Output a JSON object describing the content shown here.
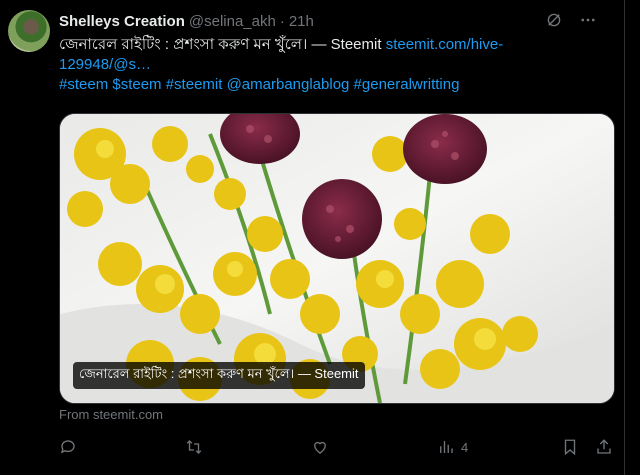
{
  "author": {
    "name": "Shelleys Creation",
    "handle": "@selina_akh",
    "separator": "·",
    "time": "21h"
  },
  "post": {
    "text_main": "জেনারেল রাইটিং : প্রশংসা করুণ মন খুঁলে। — Steemit ",
    "link_text": "steemit.com/hive-129948/@s…",
    "hashtags": "#steem $steem #steemit @amarbanglablog #generalwritting"
  },
  "card": {
    "title": "জেনারেল রাইটিং : প্রশংসা করুণ মন খুঁলে। — Steemit",
    "from_label": "From steemit.com"
  },
  "actions": {
    "views_count": "4"
  },
  "icons": {
    "grok": "slash-circle-icon",
    "more": "more-dots-icon",
    "reply": "reply-icon",
    "repost": "repost-icon",
    "like": "heart-icon",
    "views": "views-icon",
    "bookmark": "bookmark-icon",
    "share": "share-icon"
  },
  "colors": {
    "background": "#000000",
    "text": "#e7e9ea",
    "muted": "#71767b",
    "link": "#1d9bf0",
    "border": "#2f3336"
  }
}
